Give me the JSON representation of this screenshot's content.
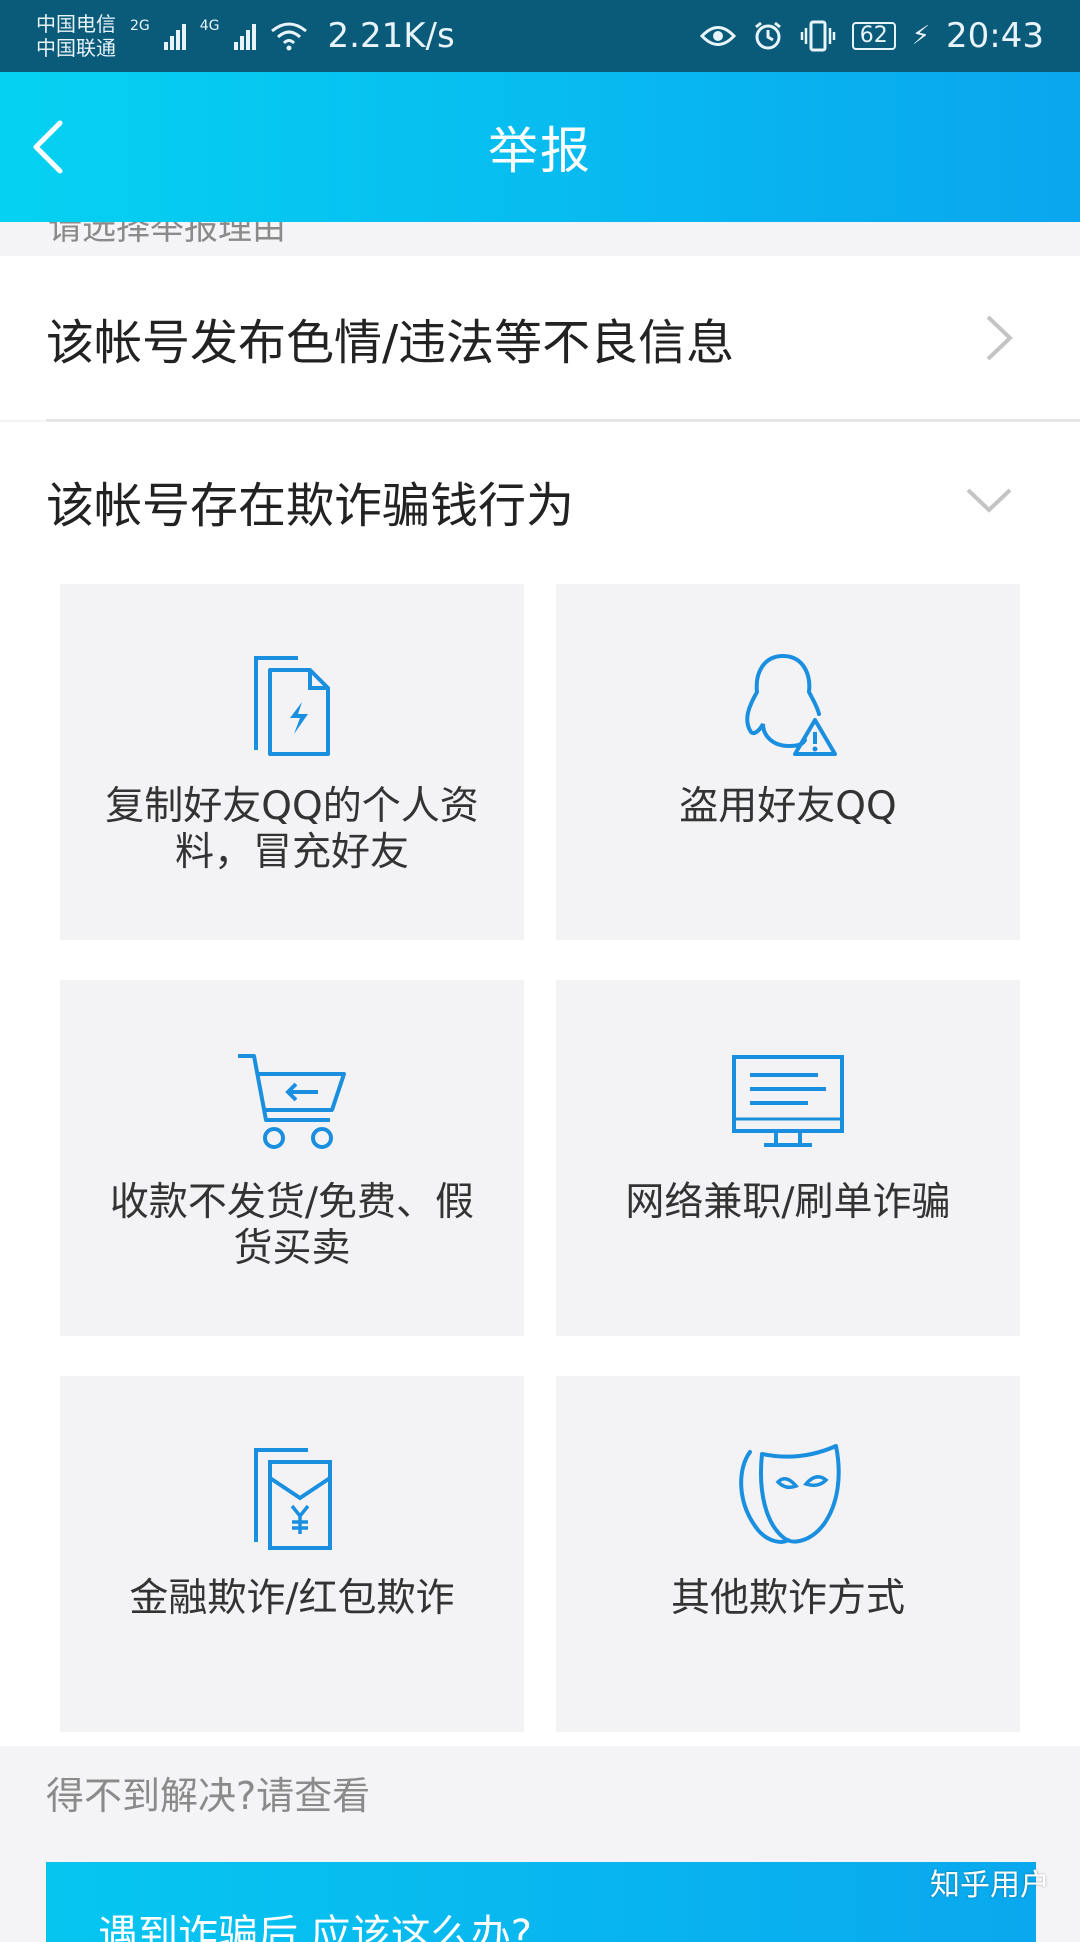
{
  "status_bar": {
    "carrier_1": "中国电信",
    "carrier_2": "中国联通",
    "net_1": "2G",
    "net_2": "4G",
    "speed": "2.21K/s",
    "battery": "62",
    "time": "20:43"
  },
  "header": {
    "title": "举报"
  },
  "section_label": "请选择举报理由",
  "rows": [
    {
      "label": "该帐号发布色情/违法等不良信息"
    },
    {
      "label": "该帐号存在欺诈骗钱行为"
    }
  ],
  "fraud_options": [
    {
      "label": "复制好友QQ的个人资料，冒充好友",
      "icon": "copy-profile-icon"
    },
    {
      "label": "盗用好友QQ",
      "icon": "penguin-warning-icon"
    },
    {
      "label": "收款不发货/免费、假货买卖",
      "icon": "shopping-cart-icon"
    },
    {
      "label": "网络兼职/刷单诈骗",
      "icon": "monitor-icon"
    },
    {
      "label": "金融欺诈/红包欺诈",
      "icon": "red-envelope-icon"
    },
    {
      "label": "其他欺诈方式",
      "icon": "mask-icon"
    }
  ],
  "help_text": "得不到解决?请查看",
  "banner_text": "遇到诈骗后,应该这么办?",
  "watermark": "知乎用户",
  "colors": {
    "accent": "#0aa6ee",
    "icon_blue": "#1a8fe0",
    "status_bar": "#0a5a7a"
  }
}
